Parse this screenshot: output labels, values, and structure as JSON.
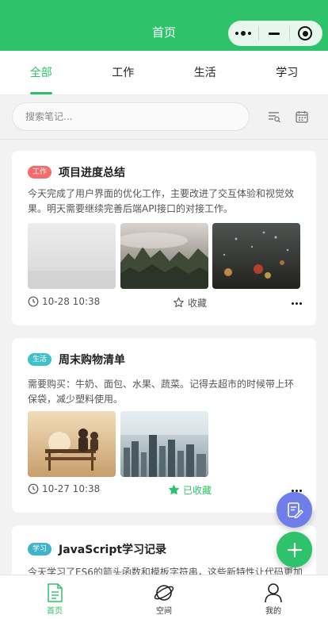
{
  "header": {
    "title": "首页"
  },
  "tabs": [
    {
      "label": "全部",
      "active": true
    },
    {
      "label": "工作",
      "active": false
    },
    {
      "label": "生活",
      "active": false
    },
    {
      "label": "学习",
      "active": false
    }
  ],
  "search": {
    "placeholder": "搜索笔记...",
    "value": ""
  },
  "toolbar": {
    "icons": [
      "filter-list-icon",
      "calendar-icon"
    ]
  },
  "notes": [
    {
      "tag": "工作",
      "tag_color": "#f76b6b",
      "title": "项目进度总结",
      "content": "今天完成了用户界面的优化工作，主要改进了交互体验和视觉效果。明天需要继续完善后端API接口的对接工作。",
      "images": [
        "foggy-white-scene",
        "misty-forest-hills",
        "rainy-window-bokeh"
      ],
      "date": "10-28 10:38",
      "favorite_label": "收藏",
      "favorited": false
    },
    {
      "tag": "生活",
      "tag_color": "#3fc1c9",
      "title": "周末购物清单",
      "content": "需要购买：牛奶、面包、水果、蔬菜。记得去超市的时候带上环保袋，减少塑料使用。",
      "images": [
        "couple-on-bench-sunset",
        "misty-city-skyline"
      ],
      "date": "10-27 10:38",
      "favorite_label": "已收藏",
      "favorited": true
    },
    {
      "tag": "学习",
      "tag_color": "#3fb3c9",
      "title": "JavaScript学习记录",
      "content": "今天学习了ES6的箭头函数和模板字符串，这些新特性让代码更加"
    }
  ],
  "fabs": [
    {
      "icon": "edit-note-icon",
      "color": "#6f7ee8"
    },
    {
      "icon": "plus-icon",
      "color": "#2ec26b"
    }
  ],
  "bottom_nav": [
    {
      "label": "首页",
      "icon": "document-icon",
      "active": true
    },
    {
      "label": "空间",
      "icon": "planet-icon",
      "active": false
    },
    {
      "label": "我的",
      "icon": "user-icon",
      "active": false
    }
  ],
  "colors": {
    "accent": "#2ec26b",
    "background": "#f2f2f2",
    "card": "#ffffff"
  }
}
